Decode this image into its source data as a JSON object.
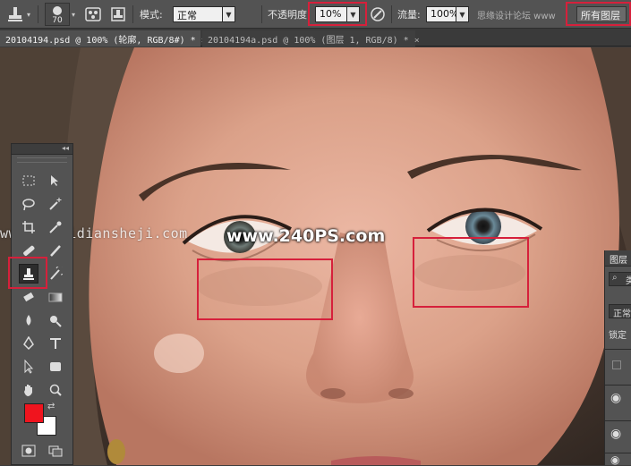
{
  "options_bar": {
    "brush_size": "70",
    "mode_label": "模式:",
    "mode_value": "正常",
    "opacity_label": "不透明度:",
    "opacity_value": "10%",
    "flow_label": "流量:",
    "flow_value": "100%",
    "sample_value": "所有图层",
    "watermark_text": "思缘设计论坛 www"
  },
  "tabs": [
    {
      "label": "20104194.psd @ 100% (轮廓, RGB/8#) *",
      "close": "×"
    },
    {
      "label": "20104194a.psd @ 100% (图层 1, RGB/8) *",
      "close": "×"
    }
  ],
  "watermarks": {
    "site1": "www.haoyidiansheji.com",
    "site2": "www.240PS.com"
  },
  "layers_panel": {
    "title": "图层",
    "search_kind": "类",
    "blend_mode": "正常",
    "lock_label": "锁定"
  },
  "colors": {
    "foreground": "#f0141e",
    "background": "#ffffff",
    "highlight": "#d6203b"
  },
  "icons": [
    "clone-stamp-tool-icon",
    "brush-preset-icon",
    "toggle-clone-source-icon",
    "pressure-opacity-icon",
    "eye-icon"
  ]
}
